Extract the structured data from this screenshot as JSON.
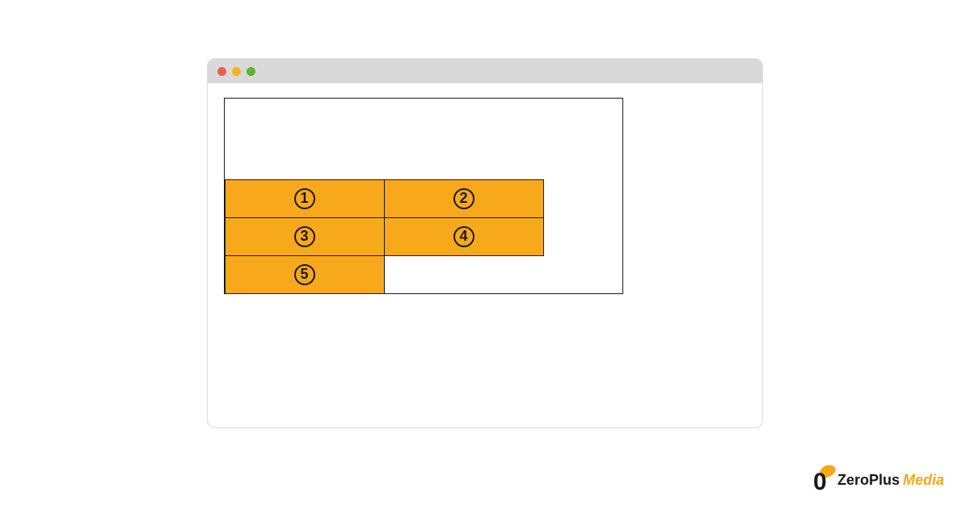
{
  "browser": {
    "traffic_lights": [
      "red",
      "yellow",
      "green"
    ]
  },
  "flex_items": [
    {
      "label": "1"
    },
    {
      "label": "2"
    },
    {
      "label": "3"
    },
    {
      "label": "4"
    },
    {
      "label": "5"
    }
  ],
  "logo": {
    "mark": "0",
    "brand": "ZeroPlus",
    "suffix": "Media"
  },
  "colors": {
    "item_bg": "#f7a81b",
    "border": "#1a1a1a",
    "titlebar": "#d9d9d9"
  }
}
